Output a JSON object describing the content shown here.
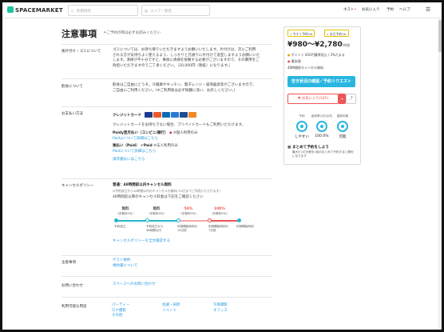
{
  "header": {
    "logo": "SPACEMARKET",
    "search_keyword_placeholder": "利用目的",
    "search_area_placeholder": "エリア・駅名",
    "nav": [
      "ホスト",
      "お気に入り",
      "予約",
      "ヘルプ"
    ]
  },
  "main": {
    "title": "注意事項",
    "title_note": "＊ご予約の際は必ずお読みください",
    "sections": {
      "cleanup": {
        "label": "後片付け・ゴミについて",
        "lines": [
          "ゴミについては、お持ち帰りいただきますようお願いいたします。片付けは、次にご利用",
          "される方が気持ちよく使えるよう、しっかりと元通りに片付けて退室しますようお願いいた",
          "します。清掃が不十分ですと、事後に清掃を依頼する必要がございますので、その費用をご",
          "負担いただきますのでご了承ください。（20,000円（税抜）になります。）"
        ]
      },
      "food": {
        "label": "飲食について",
        "lines": [
          "飲食はご自由にどうぞ。冷蔵庫やキッチン、電子レンジ・湯沸器具等がございますので、",
          "ご自由にご利用ください。(※ご利用後は必ず綺麗に洗い、お戻しください。)"
        ]
      },
      "payment": {
        "label": "お支払い方法",
        "credit_label": "クレジットカード",
        "credit_note": "クレジットカードをお持ちでない場合、プリペイドカードもご利用いただけます。",
        "paidy_label": "Paidy翌月払い（コンビニ/銀行）",
        "paidy_note": "※個人利用のみ",
        "paidy_link": "Paidyについて詳細はこちら",
        "paid_label": "後払い（Paid）",
        "paid_brand": "Paid",
        "paid_note": "※法人利用のみ",
        "paid_link": "Paidについて詳細はこちら",
        "invoice_link": "請求書払いはこちら"
      },
      "cancel": {
        "label": "キャンセルポリシー",
        "headline": "普通：48時間前以内キャンセル無料",
        "note1": "※予約成立から48時間以内のキャンセルも無料(＊8日までご利用いただけます)",
        "note2": "48時間前以降のキャンセル料金は下記をご確認ください",
        "stages": [
          {
            "pct": "無料",
            "sub": "（手数料5％）",
            "desc": "予約成立"
          },
          {
            "pct": "無料",
            "sub": "（手数料5％）",
            "desc": "予約成立から48時間以内"
          },
          {
            "pct": "50%",
            "sub": "（手数料5％）",
            "desc": "利用開始時刻の14日前"
          },
          {
            "pct": "100%",
            "sub": "（手数料5％）",
            "desc": "利用開始時刻の7日前"
          }
        ],
        "end_label": "利用開始時刻",
        "link": "キャンセルポリシーを全文確認する"
      },
      "notes": {
        "label": "注意事項",
        "links": [
          "ゲスト規約",
          "規約書について"
        ]
      },
      "contact": {
        "label": "お問い合わせ",
        "link": "スペースへのお問い合わせ"
      },
      "usage": {
        "label": "利用可能な用途",
        "items": [
          "パーティー",
          "会議・研修",
          "写真撮影",
          "ロケ撮影",
          "イベント",
          "オフィス",
          "その他"
        ]
      }
    }
  },
  "sidebar": {
    "badges": [
      "今すぐ予約OK",
      "本日予約OK"
    ],
    "price": "¥980〜¥2,780",
    "price_unit": "/時間",
    "points": "ポイント 850円獲得見込 / 3%たまる",
    "discount": "最安値",
    "review": "48時間前キャンセル無料",
    "reserve_button": "空き状況の確認／予約リクエスト",
    "favorite_button": "お気に入り(185)",
    "share_button": "シェア",
    "stats": [
      {
        "label": "予約",
        "value": "しやすい"
      },
      {
        "label": "返信率(1日以内)",
        "value": "100.0%"
      },
      {
        "label": "直前利用",
        "value": "可能"
      }
    ],
    "summary_title": "まとめて予約をしよう",
    "summary_desc": "最大5つの日程を1回のまとめて予約すると便利になります"
  },
  "colors": {
    "accent": "#29b6e0",
    "brand": "#1ec3a0",
    "favorite": "#ee5555",
    "link": "#2b9be0"
  }
}
